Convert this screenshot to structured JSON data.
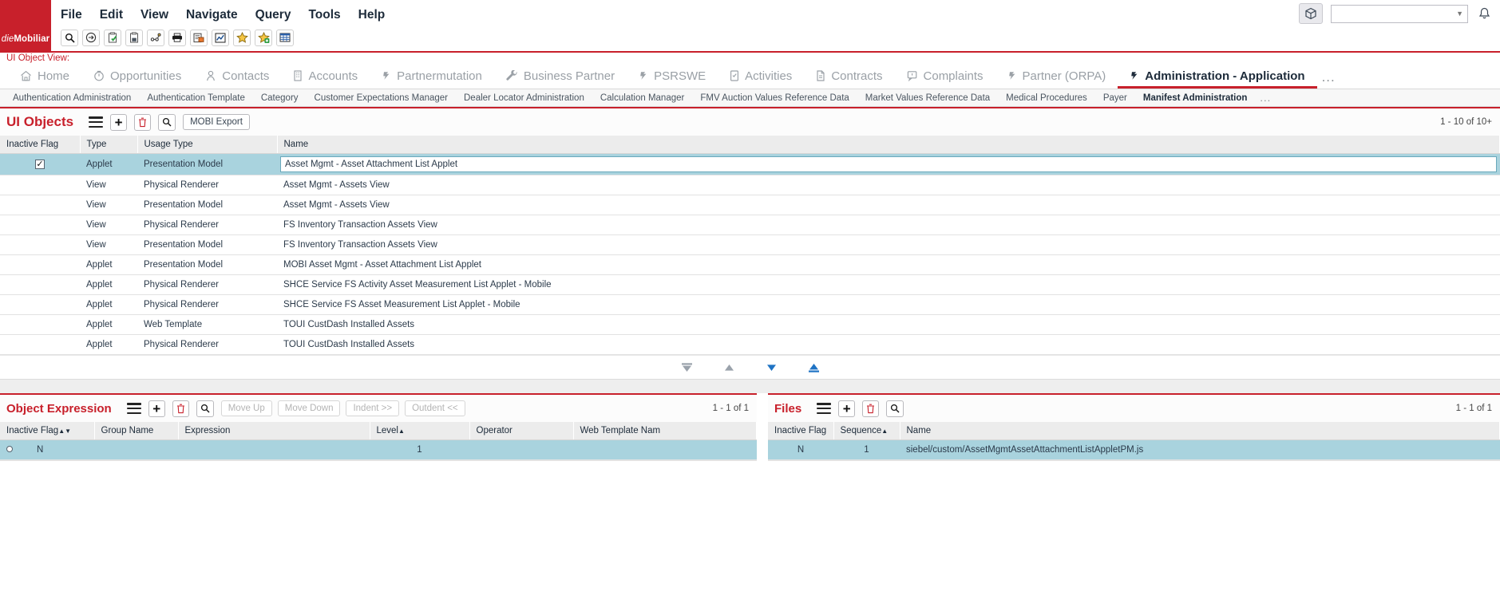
{
  "brand": {
    "logo_thin": "die",
    "logo_bold": "Mobiliar",
    "accent_red": "#c8202b",
    "select_teal": "#a9d3de"
  },
  "menubar": {
    "items": [
      "File",
      "Edit",
      "View",
      "Navigate",
      "Query",
      "Tools",
      "Help"
    ]
  },
  "toolbar": {
    "buttons": [
      {
        "name": "search-icon",
        "title": "Search"
      },
      {
        "name": "execute-query-icon",
        "title": "Execute Query"
      },
      {
        "name": "new-record-icon",
        "title": "New Record"
      },
      {
        "name": "save-record-icon",
        "title": "Save Record"
      },
      {
        "name": "site-map-icon",
        "title": "Site Map"
      },
      {
        "name": "print-icon",
        "title": "Print"
      },
      {
        "name": "reports-icon",
        "title": "Reports"
      },
      {
        "name": "charts-icon",
        "title": "Charts"
      },
      {
        "name": "favorites-icon",
        "title": "Favorites"
      },
      {
        "name": "add-favorite-icon",
        "title": "Add to Favorites"
      },
      {
        "name": "grid-icon",
        "title": "Columns Displayed"
      }
    ]
  },
  "topright": {
    "search_value": "",
    "search_placeholder": ""
  },
  "view_label": "UI Object View:",
  "nav_tabs": [
    {
      "label": "Home",
      "icon": "home-icon",
      "active": false
    },
    {
      "label": "Opportunities",
      "icon": "opportunity-icon",
      "active": false
    },
    {
      "label": "Contacts",
      "icon": "contact-icon",
      "active": false
    },
    {
      "label": "Accounts",
      "icon": "account-icon",
      "active": false
    },
    {
      "label": "Partnermutation",
      "icon": "partner-icon",
      "active": false
    },
    {
      "label": "Business Partner",
      "icon": "wrench-icon",
      "active": false
    },
    {
      "label": "PSRSWE",
      "icon": "partner-icon",
      "active": false
    },
    {
      "label": "Activities",
      "icon": "activity-icon",
      "active": false
    },
    {
      "label": "Contracts",
      "icon": "contract-icon",
      "active": false
    },
    {
      "label": "Complaints",
      "icon": "complaint-icon",
      "active": false
    },
    {
      "label": "Partner (ORPA)",
      "icon": "partner-icon",
      "active": false
    },
    {
      "label": "Administration - Application",
      "icon": "partner-icon",
      "active": true
    }
  ],
  "nav_overflow": "...",
  "sub_tabs": [
    {
      "label": "Authentication Administration",
      "active": false
    },
    {
      "label": "Authentication Template",
      "active": false
    },
    {
      "label": "Category",
      "active": false
    },
    {
      "label": "Customer Expectations Manager",
      "active": false
    },
    {
      "label": "Dealer Locator Administration",
      "active": false
    },
    {
      "label": "Calculation Manager",
      "active": false
    },
    {
      "label": "FMV Auction Values Reference Data",
      "active": false
    },
    {
      "label": "Market Values Reference Data",
      "active": false
    },
    {
      "label": "Medical Procedures",
      "active": false
    },
    {
      "label": "Payer",
      "active": false
    },
    {
      "label": "Manifest Administration",
      "active": true
    }
  ],
  "sub_overflow": "...",
  "ui_objects": {
    "title": "UI Objects",
    "buttons": {
      "menu": "menu-icon",
      "new": "+",
      "delete": "delete-icon",
      "query": "search-icon",
      "export_label": "MOBI Export"
    },
    "record_count": "1 - 10 of 10+",
    "columns": [
      "Inactive Flag",
      "Type",
      "Usage Type",
      "Name"
    ],
    "rows": [
      {
        "inactive": true,
        "type": "Applet",
        "usage": "Presentation Model",
        "name": "Asset Mgmt - Asset Attachment List Applet",
        "selected": true
      },
      {
        "inactive": false,
        "type": "View",
        "usage": "Physical Renderer",
        "name": "Asset Mgmt - Assets View",
        "selected": false
      },
      {
        "inactive": false,
        "type": "View",
        "usage": "Presentation Model",
        "name": "Asset Mgmt - Assets View",
        "selected": false
      },
      {
        "inactive": false,
        "type": "View",
        "usage": "Physical Renderer",
        "name": "FS Inventory Transaction Assets View",
        "selected": false
      },
      {
        "inactive": false,
        "type": "View",
        "usage": "Presentation Model",
        "name": "FS Inventory Transaction Assets View",
        "selected": false
      },
      {
        "inactive": false,
        "type": "Applet",
        "usage": "Presentation Model",
        "name": "MOBI Asset Mgmt - Asset Attachment List Applet",
        "selected": false
      },
      {
        "inactive": false,
        "type": "Applet",
        "usage": "Physical Renderer",
        "name": "SHCE Service FS Activity Asset Measurement List Applet - Mobile",
        "selected": false
      },
      {
        "inactive": false,
        "type": "Applet",
        "usage": "Physical Renderer",
        "name": "SHCE Service FS Asset Measurement List Applet - Mobile",
        "selected": false
      },
      {
        "inactive": false,
        "type": "Applet",
        "usage": "Web Template",
        "name": "TOUI CustDash Installed Assets",
        "selected": false
      },
      {
        "inactive": false,
        "type": "Applet",
        "usage": "Physical Renderer",
        "name": "TOUI CustDash Installed Assets",
        "selected": false
      }
    ],
    "pager": [
      {
        "name": "first-page-button",
        "enabled": false
      },
      {
        "name": "previous-page-button",
        "enabled": false
      },
      {
        "name": "next-page-button",
        "enabled": true
      },
      {
        "name": "last-page-button",
        "enabled": true
      }
    ]
  },
  "object_expression": {
    "title": "Object Expression",
    "buttons": {
      "menu": "menu-icon",
      "new": "+",
      "delete": "delete-icon",
      "query": "search-icon"
    },
    "action_buttons": [
      {
        "label": "Move Up",
        "enabled": false
      },
      {
        "label": "Move Down",
        "enabled": false
      },
      {
        "label": "Indent >>",
        "enabled": false
      },
      {
        "label": "Outdent <<",
        "enabled": false
      }
    ],
    "record_count": "1 - 1 of 1",
    "columns": [
      "Inactive Flag",
      "Group Name",
      "Expression",
      "Level",
      "Operator",
      "Web Template Nam"
    ],
    "sort_inactive": "▲▼",
    "sort_level": "▲",
    "rows": [
      {
        "marker": "o",
        "inactive": "N",
        "group": "",
        "expression": "",
        "level": "1",
        "operator": "",
        "web_template": "",
        "selected": true
      }
    ]
  },
  "files": {
    "title": "Files",
    "buttons": {
      "menu": "menu-icon",
      "new": "+",
      "delete": "delete-icon",
      "query": "search-icon"
    },
    "record_count": "1 - 1 of 1",
    "columns": [
      "Inactive Flag",
      "Sequence",
      "Name"
    ],
    "sort_sequence": "▲",
    "rows": [
      {
        "inactive": "N",
        "sequence": "1",
        "name": "siebel/custom/AssetMgmtAssetAttachmentListAppletPM.js",
        "selected": true
      }
    ]
  }
}
